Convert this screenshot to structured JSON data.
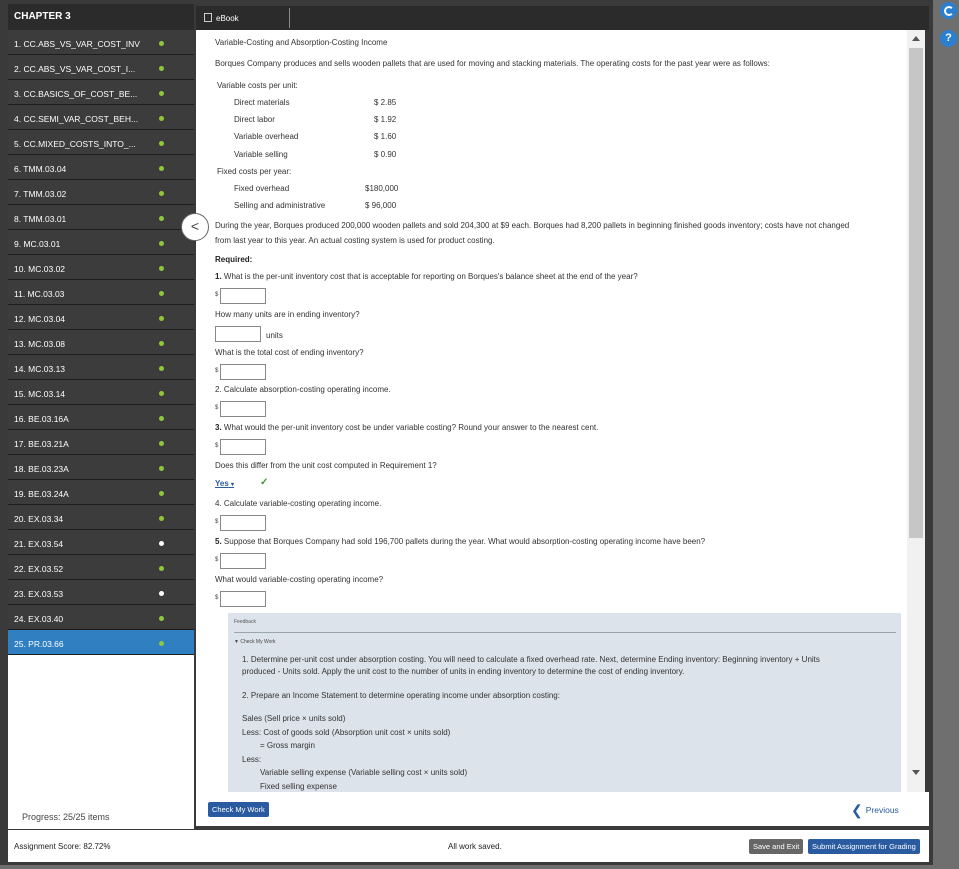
{
  "sidebar": {
    "chapter": "CHAPTER 3",
    "items": [
      {
        "label": "1. CC.ABS_VS_VAR_COST_INV",
        "status": "complete"
      },
      {
        "label": "2. CC.ABS_VS_VAR_COST_I...",
        "status": "complete"
      },
      {
        "label": "3. CC.BASICS_OF_COST_BE...",
        "status": "complete"
      },
      {
        "label": "4. CC.SEMI_VAR_COST_BEH...",
        "status": "complete"
      },
      {
        "label": "5. CC.MIXED_COSTS_INTO_...",
        "status": "complete"
      },
      {
        "label": "6. TMM.03.04",
        "status": "complete"
      },
      {
        "label": "7. TMM.03.02",
        "status": "complete"
      },
      {
        "label": "8. TMM.03.01",
        "status": "complete"
      },
      {
        "label": "9. MC.03.01",
        "status": "complete"
      },
      {
        "label": "10. MC.03.02",
        "status": "complete"
      },
      {
        "label": "11. MC.03.03",
        "status": "complete"
      },
      {
        "label": "12. MC.03.04",
        "status": "complete"
      },
      {
        "label": "13. MC.03.08",
        "status": "complete"
      },
      {
        "label": "14. MC.03.13",
        "status": "complete"
      },
      {
        "label": "15. MC.03.14",
        "status": "complete"
      },
      {
        "label": "16. BE.03.16A",
        "status": "complete"
      },
      {
        "label": "17. BE.03.21A",
        "status": "complete"
      },
      {
        "label": "18. BE.03.23A",
        "status": "complete"
      },
      {
        "label": "19. BE.03.24A",
        "status": "complete"
      },
      {
        "label": "20. EX.03.34",
        "status": "complete"
      },
      {
        "label": "21. EX.03.54",
        "status": "incomplete"
      },
      {
        "label": "22. EX.03.52",
        "status": "complete"
      },
      {
        "label": "23. EX.03.53",
        "status": "incomplete"
      },
      {
        "label": "24. EX.03.40",
        "status": "complete"
      },
      {
        "label": "25. PR.03.66",
        "status": "complete",
        "active": true
      }
    ],
    "progress": "Progress: 25/25 items"
  },
  "topbar": {
    "ebook_label": "eBook"
  },
  "problem": {
    "title": "Variable-Costing and Absorption-Costing Income",
    "intro": "Borques Company produces and sells wooden pallets that are used for moving and stacking materials. The operating costs for the past year were as follows:",
    "variable_header": "Variable costs per unit:",
    "variable_costs": [
      {
        "label": "Direct materials",
        "value": "$ 2.85"
      },
      {
        "label": "Direct labor",
        "value": "$ 1.92"
      },
      {
        "label": "Variable overhead",
        "value": "$ 1.60"
      },
      {
        "label": "Variable selling",
        "value": "$ 0.90"
      }
    ],
    "fixed_header": "Fixed costs per year:",
    "fixed_costs": [
      {
        "label": "Fixed overhead",
        "value": "$180,000"
      },
      {
        "label": "Selling and administrative",
        "value": "$ 96,000"
      }
    ],
    "paragraph_1": "During the year, Borques produced 200,000 wooden pallets and sold 204,300 at $9 each. Borques had 8,200 pallets in beginning finished goods inventory; costs have not changed",
    "paragraph_2": "from last year to this year. An actual costing system is used for product costing.",
    "required": "Required:",
    "q1_num": "1.",
    "q1": "What is the per-unit inventory cost that is acceptable for reporting on Borques's balance sheet at the end of the year?",
    "q1b": "How many units are in ending inventory?",
    "units_label": "units",
    "q1c": "What is the total cost of ending inventory?",
    "q2": "2. Calculate absorption-costing operating income.",
    "q3_num": "3.",
    "q3": "What would the per-unit inventory cost be under variable costing? Round your answer to the nearest cent.",
    "q3b": "Does this differ from the unit cost computed in Requirement 1?",
    "q3_answer": "Yes",
    "q4": "4. Calculate variable-costing operating income.",
    "q5_num": "5.",
    "q5": "Suppose that Borques Company had sold 196,700 pallets during the year. What would absorption-costing operating income have been?",
    "q5b": "What would variable-costing operating income?",
    "dollar_sign": "$"
  },
  "feedback": {
    "title": "Feedback",
    "check_header": "▼ Check My Work",
    "p1_line1": "1. Determine per-unit cost under absorption costing. You will need to calculate a fixed overhead rate. Next, determine Ending inventory: Beginning inventory + Units",
    "p1_line2": "produced - Units sold. Apply the unit cost to the number of units in ending inventory to determine the cost of ending inventory.",
    "p2": "2. Prepare an Income Statement to determine operating income under absorption costing:",
    "sales": "Sales (Sell price × units sold)",
    "cogs": "Less: Cost of goods sold (Absorption unit cost × units sold)",
    "gross": "= Gross margin",
    "less": "Less:",
    "var_sell": "Variable selling expense (Variable selling cost × units sold)",
    "fixed_sell": "Fixed selling expense"
  },
  "bottom": {
    "check_label": "Check My Work",
    "previous_label": "Previous"
  },
  "footer": {
    "score": "Assignment Score:  82.72%",
    "saved": "All work saved.",
    "save_exit": "Save and Exit",
    "submit": "Submit Assignment for Grading"
  },
  "colors": {
    "accent": "#2a5aa0",
    "active_item": "#2f7fc1",
    "complete_dot": "#8fc93a",
    "check": "#3a9a2a"
  }
}
